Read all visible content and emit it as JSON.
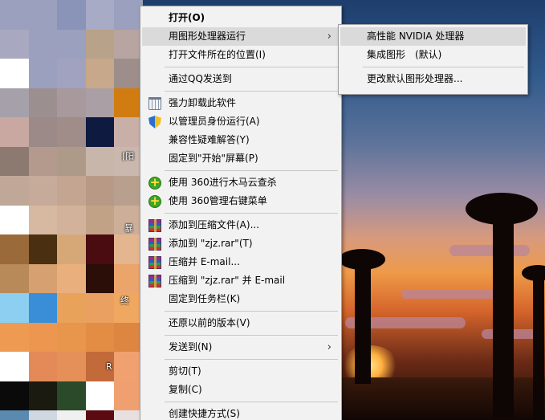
{
  "desktop": {
    "icon_labels": [
      "[阳",
      "暴",
      "终",
      "R"
    ],
    "mosaic_colors": [
      "#9aa0bd",
      "#9aa0bd",
      "#8a93b8",
      "#a8abc6",
      "#9aa0bd",
      "#a8a8c0",
      "#9aa0bd",
      "#9aa0bd",
      "#b9a28a",
      "#b8a4a0",
      "#ffffff",
      "#9aa0bd",
      "#a0a2bf",
      "#c7a88a",
      "#9d8e8c",
      "#a5a0aa",
      "#9c8f90",
      "#a7999c",
      "#ab9fa6",
      "#d07c10",
      "#c8a8a0",
      "#9c8a88",
      "#a08c88",
      "#0e1a40",
      "#c8b0a8",
      "#8c7a70",
      "#b49a8c",
      "#ad9a88",
      "#c9b6aa",
      "#cab8ae",
      "#c0a898",
      "#c6aa9a",
      "#c3a592",
      "#b79a86",
      "#b9a08e",
      "#ffffff",
      "#d7b8a0",
      "#d2b29a",
      "#c2a286",
      "#cdae98",
      "#9a6a3a",
      "#4a2f10",
      "#d6a878",
      "#4a0c10",
      "#e4b690",
      "#b88a5a",
      "#d6a070",
      "#e9b07e",
      "#2c0e08",
      "#eba46a",
      "#8ccff0",
      "#3a8ed8",
      "#e9a25a",
      "#eaa060",
      "#f0a860",
      "#ee9a52",
      "#ec9650",
      "#e7964c",
      "#e38c44",
      "#dd8642",
      "#ffffff",
      "#e48a58",
      "#e49058",
      "#c26a3a",
      "#f1a070",
      "#0a0a0a",
      "#1a1a10",
      "#2a4a2a",
      "#ffffff",
      "#f0a070",
      "#5a8ab0",
      "#cfd7e0",
      "#f0f0f0",
      "#5a0a10",
      "#e8e0e0"
    ]
  },
  "context_menu": {
    "items": [
      {
        "label": "打开(O)"
      },
      {
        "label": "用图形处理器运行"
      },
      {
        "label": "打开文件所在的位置(I)"
      },
      {
        "label": "通过QQ发送到"
      },
      {
        "label": "强力卸载此软件"
      },
      {
        "label": "以管理员身份运行(A)"
      },
      {
        "label": "兼容性疑难解答(Y)"
      },
      {
        "label": "固定到\"开始\"屏幕(P)"
      },
      {
        "label": "使用 360进行木马云查杀"
      },
      {
        "label": "使用 360管理右键菜单"
      },
      {
        "label": "添加到压缩文件(A)..."
      },
      {
        "label": "添加到 \"zjz.rar\"(T)"
      },
      {
        "label": "压缩并 E-mail..."
      },
      {
        "label": "压缩到 \"zjz.rar\" 并 E-mail"
      },
      {
        "label": "固定到任务栏(K)"
      },
      {
        "label": "还原以前的版本(V)"
      },
      {
        "label": "发送到(N)"
      },
      {
        "label": "剪切(T)"
      },
      {
        "label": "复制(C)"
      },
      {
        "label": "创建快捷方式(S)"
      }
    ],
    "submenu_arrow": "›"
  },
  "gpu_submenu": {
    "items": [
      {
        "label": "高性能 NVIDIA 处理器"
      },
      {
        "label": "集成图形　(默认)"
      },
      {
        "label": "更改默认图形处理器..."
      }
    ]
  },
  "colors": {
    "menu_bg": "#f2f2f2",
    "menu_highlight": "#dadada",
    "menu_border": "#a0a0a0"
  }
}
